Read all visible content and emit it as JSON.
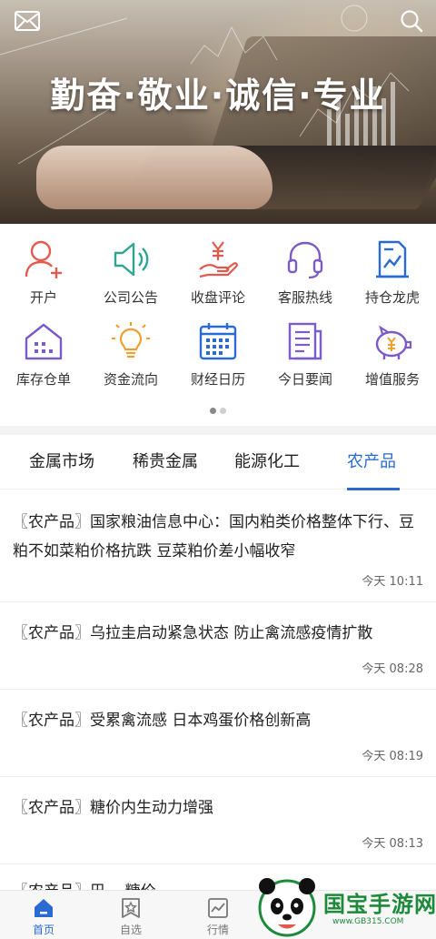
{
  "banner": {
    "slogan": "勤奋·敬业·诚信·专业"
  },
  "header_icons": {
    "mail": "mail-icon",
    "search": "search-icon"
  },
  "grid": {
    "row1": [
      {
        "label": "开户",
        "icon": "user-add-icon",
        "color": "#e05a4e"
      },
      {
        "label": "公司公告",
        "icon": "speaker-icon",
        "color": "#2fa58f"
      },
      {
        "label": "收盘评论",
        "icon": "hand-yen-icon",
        "color": "#e05a4e"
      },
      {
        "label": "客服热线",
        "icon": "headset-icon",
        "color": "#7a5bc7"
      },
      {
        "label": "持仓龙虎",
        "icon": "chart-doc-icon",
        "color": "#2a6bd1"
      }
    ],
    "row2": [
      {
        "label": "库存仓单",
        "icon": "warehouse-icon",
        "color": "#7a5bc7"
      },
      {
        "label": "资金流向",
        "icon": "bulb-icon",
        "color": "#f0a030"
      },
      {
        "label": "财经日历",
        "icon": "calendar-icon",
        "color": "#2a6bd1"
      },
      {
        "label": "今日要闻",
        "icon": "newspaper-icon",
        "color": "#7a5bc7"
      },
      {
        "label": "增值服务",
        "icon": "piggy-yen-icon",
        "color": "#7a5bc7"
      }
    ],
    "page_dots": {
      "count": 2,
      "active": 0
    }
  },
  "tabs": [
    {
      "label": "金属市场",
      "active": false
    },
    {
      "label": "稀贵金属",
      "active": false
    },
    {
      "label": "能源化工",
      "active": false
    },
    {
      "label": "农产品",
      "active": true
    }
  ],
  "news": [
    {
      "title": "〖农产品〗国家粮油信息中心：国内粕类价格整体下行、豆粕不如菜粕价格抗跌 豆菜粕价差小幅收窄",
      "time": "今天 10:11"
    },
    {
      "title": "〖农产品〗乌拉圭启动紧急状态 防止禽流感疫情扩散",
      "time": "今天 08:28"
    },
    {
      "title": "〖农产品〗受累禽流感 日本鸡蛋价格创新高",
      "time": "今天 08:19"
    },
    {
      "title": "〖农产品〗糖价内生动力增强",
      "time": "今天 08:13"
    },
    {
      "title": "〖农产品〗巴... 糖价...",
      "time": ""
    }
  ],
  "tabbar": [
    {
      "label": "首页",
      "icon": "home-icon",
      "active": true
    },
    {
      "label": "自选",
      "icon": "star-icon",
      "active": false
    },
    {
      "label": "行情",
      "icon": "chart-line-icon",
      "active": false
    }
  ],
  "watermark": {
    "text": "国宝手游网",
    "url": "www.GB315.COM"
  },
  "colors": {
    "accent": "#2a6bd1",
    "banner_text": "#ffffff"
  }
}
